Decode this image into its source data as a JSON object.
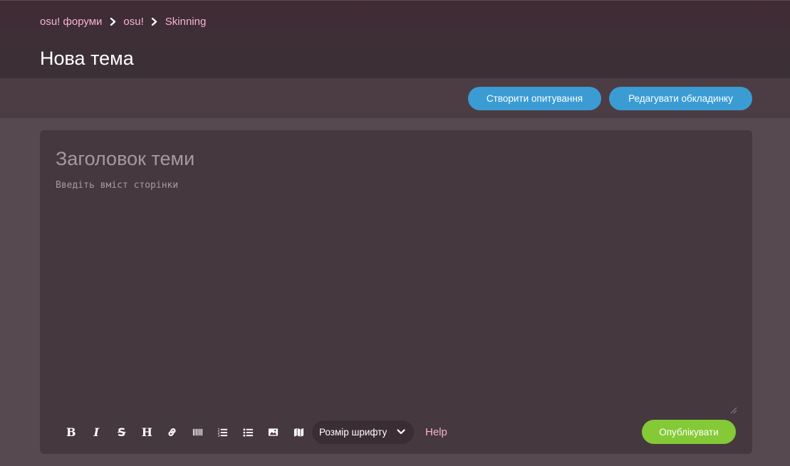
{
  "breadcrumb": {
    "items": [
      "osu! форуми",
      "osu!",
      "Skinning"
    ]
  },
  "page": {
    "title": "Нова тема"
  },
  "actions": {
    "create_poll": "Створити опитування",
    "edit_cover": "Редагувати обкладинку"
  },
  "editor": {
    "title_placeholder": "Заголовок теми",
    "body_placeholder": "Введіть вміст сторінки",
    "toolbar": {
      "tools": [
        "bold-icon",
        "italic-icon",
        "strikethrough-icon",
        "heading-icon",
        "link-icon",
        "spoiler-icon",
        "ordered-list-icon",
        "unordered-list-icon",
        "image-icon",
        "map-icon"
      ],
      "font_size_label": "Розмір шрифту",
      "help_label": "Help"
    },
    "publish_label": "Опублікувати"
  },
  "colors": {
    "page_background": "#574950",
    "editor_background": "#46383f",
    "accent_blue": "#3b9cd4",
    "accent_green": "#84c936",
    "link_pink": "#f6b5d2"
  }
}
